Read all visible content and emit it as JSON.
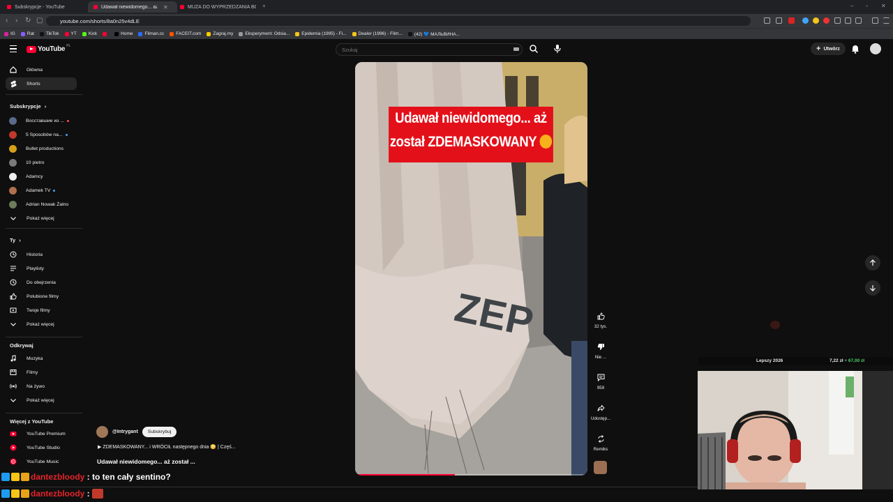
{
  "browser": {
    "tabs": [
      {
        "title": "Subskrypcje - YouTube",
        "active": false
      },
      {
        "title": "Udawał niewidomego... aż zo",
        "active": true
      },
      {
        "title": "MUZA DO WYPRZEDZANIA BOEING",
        "active": false
      }
    ],
    "url": "youtube.com/shorts/8a0n25v4dLE",
    "bookmarks": [
      {
        "label": "IG",
        "color": "#d6249f"
      },
      {
        "label": "Rat",
        "color": "#8a5cff"
      },
      {
        "label": "TikTok",
        "color": "#111111"
      },
      {
        "label": "YT",
        "color": "#ff0033"
      },
      {
        "label": "Kick",
        "color": "#53fc18"
      },
      {
        "label": "",
        "color": "#ff0033"
      },
      {
        "label": "Home",
        "color": "#000000"
      },
      {
        "label": "Filman.cc",
        "color": "#2b6cff"
      },
      {
        "label": "FACEIT.com",
        "color": "#ff5500"
      },
      {
        "label": "Zagraj.my",
        "color": "#ffcc00"
      },
      {
        "label": "Eksperyment: Odsia...",
        "color": "#999999"
      },
      {
        "label": "Epidemia (1995) - Fi...",
        "color": "#f5c518"
      },
      {
        "label": "Dealer (1996) - Film...",
        "color": "#f5c518"
      },
      {
        "label": "(42) 💙 МАЛЬВИНА...",
        "color": "#111111"
      }
    ]
  },
  "header": {
    "logo_text": "YouTube",
    "logo_region": "PL",
    "search_placeholder": "Szukaj",
    "create_label": "Utwórz"
  },
  "sidebar": {
    "main": [
      {
        "label": "Główna",
        "icon": "home-icon",
        "selected": false
      },
      {
        "label": "Shorts",
        "icon": "shorts-icon",
        "selected": true
      }
    ],
    "subs_heading": "Subskrypcje",
    "subs": [
      {
        "label": "Восставшие из ...",
        "color": "#5a6a8a",
        "dot": true,
        "dot_color": "#ff4e45"
      },
      {
        "label": "5 Sposobów na...",
        "color": "#c0392b",
        "dot": true,
        "dot_color": "#3ea6ff"
      },
      {
        "label": "Bullet productions",
        "color": "#d4a017",
        "dot": false
      },
      {
        "label": "10 pietro",
        "color": "#7a7a7a",
        "dot": false
      },
      {
        "label": "Adamcy",
        "color": "#eeeeee",
        "dot": false
      },
      {
        "label": "Adamek TV",
        "color": "#b07050",
        "dot": true,
        "dot_color": "#3ea6ff"
      },
      {
        "label": "Adrian Nowak Żalno",
        "color": "#6d7c5a",
        "dot": false
      }
    ],
    "subs_more": "Pokaż więcej",
    "you_heading": "Ty",
    "you": [
      {
        "label": "Historia",
        "icon": "history-icon"
      },
      {
        "label": "Playlisty",
        "icon": "playlists-icon"
      },
      {
        "label": "Do obejrzenia",
        "icon": "watch-later-icon"
      },
      {
        "label": "Polubione filmy",
        "icon": "liked-icon"
      },
      {
        "label": "Twoje filmy",
        "icon": "your-videos-icon"
      },
      {
        "label": "Pokaż więcej",
        "icon": "chevron-down-icon"
      }
    ],
    "explore_heading": "Odkrywaj",
    "explore": [
      {
        "label": "Muzyka",
        "icon": "music-icon"
      },
      {
        "label": "Filmy",
        "icon": "film-icon"
      },
      {
        "label": "Na żywo",
        "icon": "live-icon"
      },
      {
        "label": "Pokaż więcej",
        "icon": "chevron-down-icon"
      }
    ],
    "more_heading": "Więcej z YouTube",
    "more": [
      {
        "label": "YouTube Premium",
        "icon": "yt-premium-icon"
      },
      {
        "label": "YouTube Studio",
        "icon": "yt-studio-icon"
      },
      {
        "label": "YouTube Music",
        "icon": "yt-music-icon"
      }
    ]
  },
  "short": {
    "caption_line1": "Udawał niewidomego... aż",
    "caption_line2": "został ZDEMASKOWANY",
    "channel": "@Intrygant",
    "subscribe_label": "Subskrybuj",
    "description": "▶ ZDEMASKOWANY... i WRÓCIŁ następnego dnia 😳 | Częś...",
    "title": "Udawał niewidomego... aż został ...",
    "progress": 0.43
  },
  "actions": {
    "like": "32 tys.",
    "dislike": "Nie ...",
    "comments": "959",
    "share": "Udostęp...",
    "remix": "Remiks"
  },
  "overlay": {
    "label": "Lepszy 2026",
    "price": "7,22 zł",
    "change": "+ 67,00 zł"
  },
  "chat": [
    {
      "user": "dantezbloody",
      "message": "to ten cały sentino?"
    },
    {
      "user": "dantezbloody",
      "message": ""
    }
  ]
}
